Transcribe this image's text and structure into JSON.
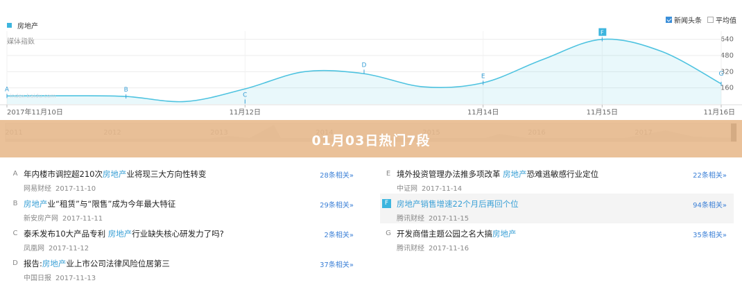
{
  "legend": {
    "series_name": "房地产",
    "sub_label": "媒体指数",
    "color": "#3cb5de"
  },
  "toggles": [
    {
      "label": "新闻头条",
      "checked": true
    },
    {
      "label": "平均值",
      "checked": false
    }
  ],
  "watermark": "index.baidu.com",
  "chart_data": {
    "type": "area",
    "series": [
      {
        "name": "房地产",
        "color": "#4ec3e0"
      }
    ],
    "x_dates": [
      "2017-11-10",
      "2017-11-12",
      "2017-11-14",
      "2017-11-15",
      "2017-11-16"
    ],
    "x": [
      0,
      0.5,
      1,
      1.5,
      2,
      2.5,
      3,
      3.5,
      4,
      4.5,
      5,
      5.5,
      6
    ],
    "values": [
      80,
      82,
      75,
      25,
      150,
      320,
      300,
      170,
      210,
      440,
      640,
      520,
      200
    ],
    "x_tick_labels": [
      "2017年11月10日",
      "11月12日",
      "11月14日",
      "11月15日",
      "11月16日"
    ],
    "y_ticks": [
      160,
      320,
      480,
      640
    ],
    "ylim": [
      0,
      720
    ],
    "markers": [
      {
        "label": "A",
        "x": 0,
        "y": 80
      },
      {
        "label": "B",
        "x": 1,
        "y": 75
      },
      {
        "label": "C",
        "x": 2,
        "y": 25
      },
      {
        "label": "D",
        "x": 3,
        "y": 320
      },
      {
        "label": "E",
        "x": 4,
        "y": 210
      },
      {
        "label": "F",
        "x": 5,
        "y": 640
      },
      {
        "label": "G",
        "x": 6,
        "y": 200
      }
    ],
    "overview_years": [
      "2011",
      "2012",
      "2013",
      "2014",
      "2015",
      "2016",
      "2017"
    ],
    "grid": true
  },
  "overlay": {
    "title": "01月03日热门7段"
  },
  "news": {
    "left": [
      {
        "letter": "A",
        "parts": [
          [
            "年内楼市调控超210次",
            false
          ],
          [
            "房地产",
            true
          ],
          [
            "业将现三大方向性转变",
            false
          ]
        ],
        "source": "网易财经",
        "date": "2017-11-10",
        "related": "28条相关»"
      },
      {
        "letter": "B",
        "parts": [
          [
            "房地产",
            true
          ],
          [
            "业“租赁”与“限售”成为今年最大特征",
            false
          ]
        ],
        "source": "新安房产网",
        "date": "2017-11-11",
        "related": "29条相关»"
      },
      {
        "letter": "C",
        "parts": [
          [
            "泰禾发布10大产品专利 ",
            false
          ],
          [
            "房地产",
            true
          ],
          [
            "行业缺失核心研发力了吗?",
            false
          ]
        ],
        "source": "凤凰网",
        "date": "2017-11-12",
        "related": "2条相关»"
      },
      {
        "letter": "D",
        "parts": [
          [
            "报告:",
            false
          ],
          [
            "房地产",
            true
          ],
          [
            "业上市公司法律风险位居第三",
            false
          ]
        ],
        "source": "中国日报",
        "date": "2017-11-13",
        "related": "37条相关»"
      }
    ],
    "right": [
      {
        "letter": "E",
        "parts": [
          [
            "境外投资管理办法推多项改革 ",
            false
          ],
          [
            "房地产",
            true
          ],
          [
            "恐难逃敏感行业定位",
            false
          ]
        ],
        "source": "中证网",
        "date": "2017-11-14",
        "related": "22条相关»"
      },
      {
        "letter": "F",
        "active": true,
        "parts": [
          [
            "房地产销售增速22个月后再回个位",
            false
          ]
        ],
        "source": "腾讯财经",
        "date": "2017-11-15",
        "related": "94条相关»"
      },
      {
        "letter": "G",
        "parts": [
          [
            "开发商借主题公园之名大搞",
            false
          ],
          [
            "房地产",
            true
          ]
        ],
        "source": "腾讯财经",
        "date": "2017-11-16",
        "related": "35条相关»"
      }
    ]
  }
}
